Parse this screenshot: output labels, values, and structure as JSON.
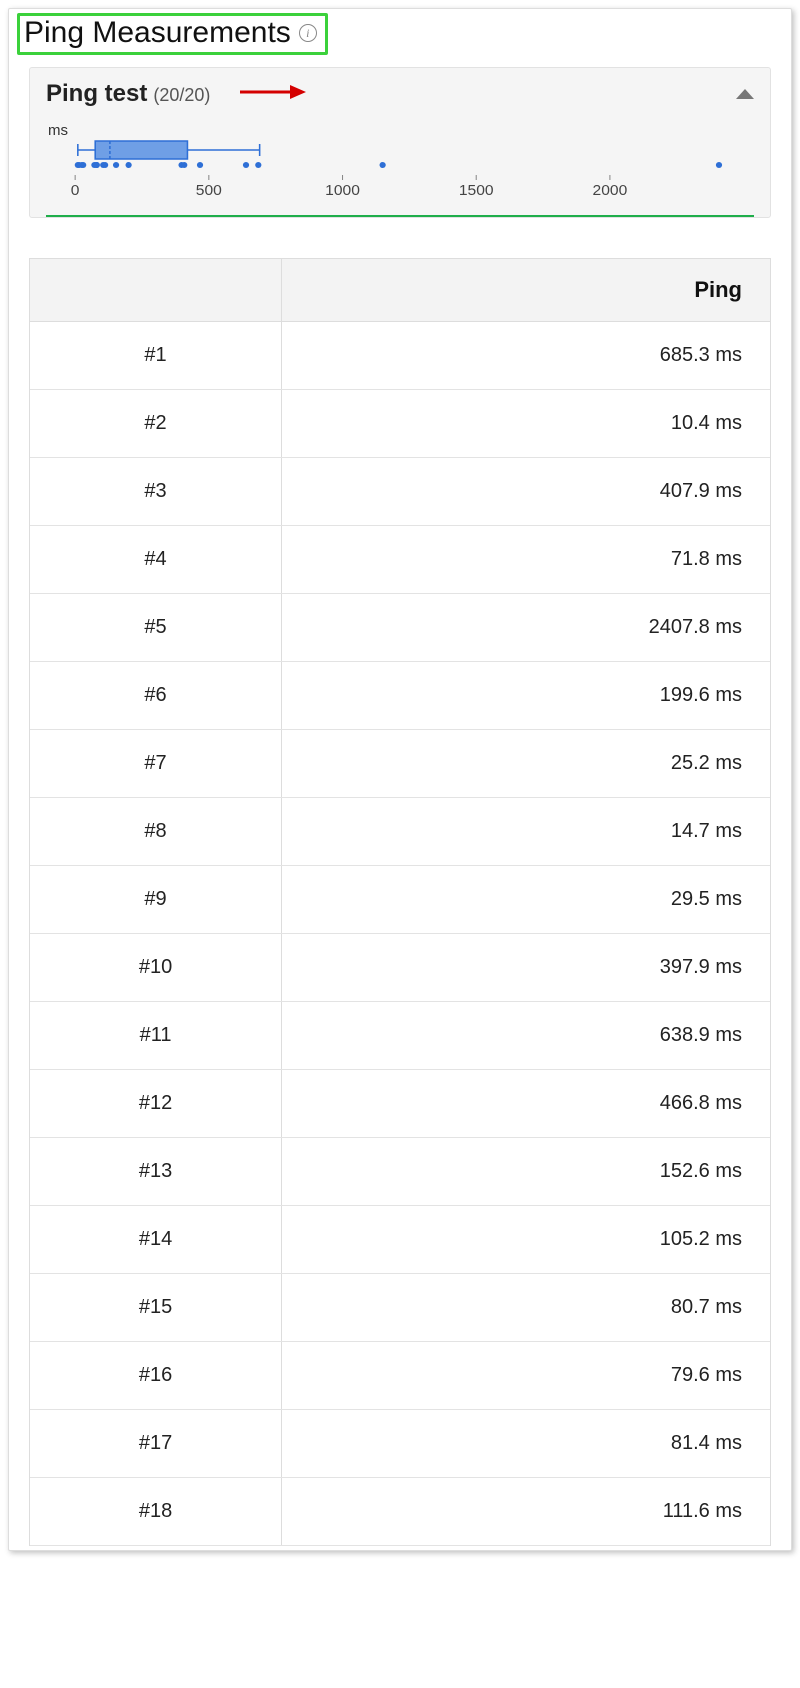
{
  "header": {
    "title": "Ping Measurements"
  },
  "summary": {
    "title": "Ping test",
    "count_label": "(20/20)",
    "unit_label": "ms",
    "axis_ticks": [
      "0",
      "500",
      "1000",
      "1500",
      "2000"
    ]
  },
  "table": {
    "columns": [
      "",
      "Ping"
    ],
    "rows": [
      {
        "idx": "#1",
        "ping": "685.3 ms"
      },
      {
        "idx": "#2",
        "ping": "10.4 ms"
      },
      {
        "idx": "#3",
        "ping": "407.9 ms"
      },
      {
        "idx": "#4",
        "ping": "71.8 ms"
      },
      {
        "idx": "#5",
        "ping": "2407.8 ms"
      },
      {
        "idx": "#6",
        "ping": "199.6 ms"
      },
      {
        "idx": "#7",
        "ping": "25.2 ms"
      },
      {
        "idx": "#8",
        "ping": "14.7 ms"
      },
      {
        "idx": "#9",
        "ping": "29.5 ms"
      },
      {
        "idx": "#10",
        "ping": "397.9 ms"
      },
      {
        "idx": "#11",
        "ping": "638.9 ms"
      },
      {
        "idx": "#12",
        "ping": "466.8 ms"
      },
      {
        "idx": "#13",
        "ping": "152.6 ms"
      },
      {
        "idx": "#14",
        "ping": "105.2 ms"
      },
      {
        "idx": "#15",
        "ping": "80.7 ms"
      },
      {
        "idx": "#16",
        "ping": "79.6 ms"
      },
      {
        "idx": "#17",
        "ping": "81.4 ms"
      },
      {
        "idx": "#18",
        "ping": "111.6 ms"
      }
    ]
  },
  "chart_data": {
    "type": "boxplot",
    "unit": "ms",
    "xlim": [
      0,
      2500
    ],
    "ticks": [
      0,
      500,
      1000,
      1500,
      2000
    ],
    "box": {
      "min": 10,
      "q1": 75,
      "median": 130,
      "q3": 420,
      "max": 690
    },
    "points": [
      10,
      15,
      25,
      30,
      72,
      80,
      80,
      81,
      105,
      112,
      153,
      200,
      398,
      408,
      467,
      639,
      685,
      1150,
      2408
    ]
  }
}
